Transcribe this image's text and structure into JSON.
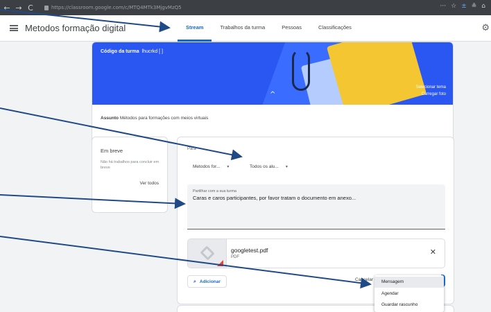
{
  "browser": {
    "nav_buttons": [
      "←",
      "→",
      "C"
    ],
    "url": "https://classroom.google.com/c/MTQ4MTk3MjgvMzQ5",
    "tool_icons": [
      "···",
      "☆",
      "±",
      "≗",
      "⌂"
    ]
  },
  "header": {
    "class_title": "Metodos formação digital",
    "tabs": [
      {
        "label": "Stream",
        "active": true
      },
      {
        "label": "Trabalhos da turma"
      },
      {
        "label": "Pessoas"
      },
      {
        "label": "Classificações"
      }
    ],
    "settings_glyph": "⚙"
  },
  "banner": {
    "code_label": "Código da turma",
    "code_value": "lhucrkd [ ]",
    "chevron": "^",
    "select_theme": "Selecionar tema",
    "upload_photo": "Carregar foto",
    "subject_label": "Assunto",
    "subject_value": "Métodos para formações com meios virtuais"
  },
  "upcoming": {
    "title": "Em breve",
    "note": "Não há trabalhos para concluir em breve",
    "link": "Ver todos"
  },
  "compose": {
    "for_label": "Para",
    "class_select": "Metodos for...",
    "audience_select": "Todos os alu...",
    "caret": "▾",
    "text_label": "Partilhar com a sua turma",
    "text_value": "Caras e caros participantes, por favor tratam o documento em anexo...",
    "attachment": {
      "name": "googletest.pdf",
      "type": "PDF",
      "remove": "✕"
    },
    "add_label": "Adicionar",
    "add_icon": "paperclip-icon",
    "cancel_label": "Cancelar"
  },
  "post_menu": {
    "items": [
      "Mensagem",
      "Agendar",
      "Guardar rascunho"
    ],
    "highlighted": "Mensagem"
  },
  "colors": {
    "accent": "#1967d2",
    "banner": "#2a57f2",
    "frame": "#5e7fa6",
    "annotation": "#1f4a86"
  }
}
